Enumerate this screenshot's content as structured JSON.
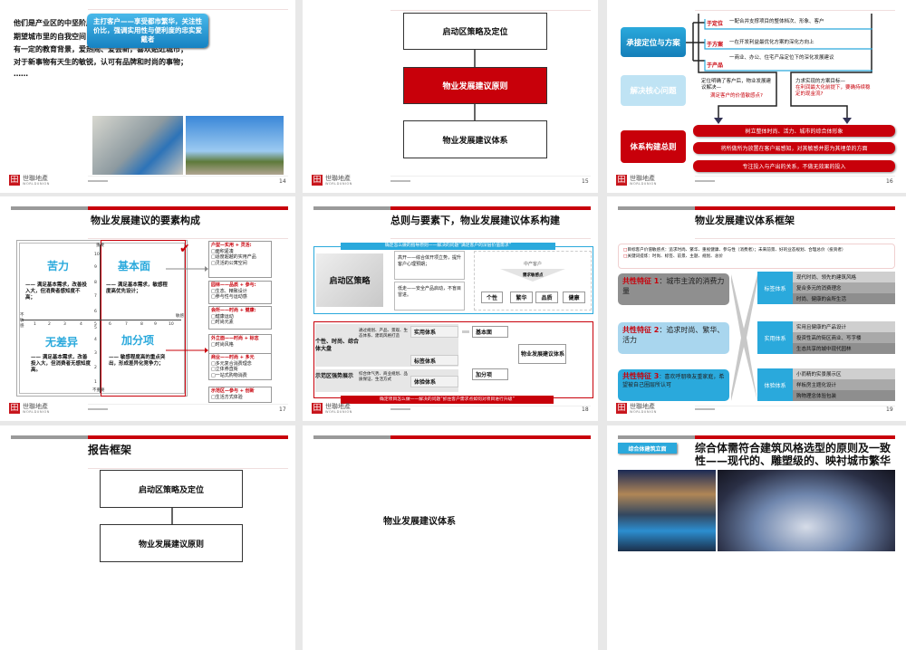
{
  "logo": {
    "cn": "世聯地產",
    "en": "WORLDUNION",
    "mark": "田"
  },
  "s14": {
    "page": "14",
    "lines": [
      "他们是产业区的中坚阶层，事业发展蒸蒸日上；",
      "期望城市里的自我空间，讲究生活便利和环境的舒适；",
      "有一定的教育背景，爱热闹、爱尝新，喜欢贴近城市；",
      "对于新事物有天生的敏锐，认可有品牌和时尚的事物；",
      "……"
    ],
    "callout": "主打客户——享受都市繁华，关注性价比，强调实用性与便利度的忠实爱戴者"
  },
  "s15": {
    "page": "15",
    "boxes": [
      "启动区策略及定位",
      "物业发展建议原则",
      "物业发展建议体系"
    ]
  },
  "s16": {
    "page": "16",
    "left": [
      "承接定位与方案",
      "解决核心问题",
      "体系构建总则"
    ],
    "branches": [
      {
        "k": "于定位",
        "v": "一配合并支撑项目的整体档次、形象、客户"
      },
      {
        "k": "于方案",
        "v": "一在开发利益最优化方案的深化方向上"
      },
      {
        "k": "于产品",
        "v": "一商业、办公、住宅产品定位下的深化发展建议"
      }
    ],
    "q_left": "定位明确了客户后，物业发展建议解决—",
    "q_left_red": "满足客户的价值敏感点?",
    "q_right": "力求实现的方案目标—",
    "q_right_red": "在利润最大化前提下，要确持续稳定的现金流?",
    "pills": [
      "树立整体时尚、活力、城市的综合体形象",
      "将所做所为放置在客户易感知，对其敏感并愿为其埋单的方面",
      "专注投入与产出的关系，不做无效果的投入"
    ]
  },
  "s17": {
    "page": "17",
    "title": "物业发展建议的要素构成",
    "quads": [
      {
        "t": "苦力",
        "d": "—— 满足基本需求，改善投入大，但消费者感知度不高；"
      },
      {
        "t": "基本面",
        "d": "—— 满足基本需求，敏感程度高优先设计；"
      },
      {
        "t": "无差异",
        "d": "—— 满足基本需求，改善投入大，但消费者无感知度高。"
      },
      {
        "t": "加分项",
        "d": "—— 敏感程度高的重点突出，形成差异化竞争力；"
      }
    ],
    "axis": {
      "top": "重要",
      "bottom": "不重要",
      "left": "不敏感",
      "right": "敏感",
      "x": [
        "1",
        "2",
        "3",
        "4",
        "5",
        "6",
        "7",
        "8",
        "9",
        "10"
      ],
      "y_up": [
        "10",
        "9",
        "8",
        "7",
        "6"
      ],
      "y_down": [
        "5",
        "4",
        "3",
        "2",
        "1"
      ]
    },
    "panels": [
      {
        "h": "户型—实用 + 灵活:",
        "items": [
          "面积紧凑",
          "适度超越的实用产品",
          "灵活的公寓空间"
        ]
      },
      {
        "h": "园林——品质 + 参与:",
        "items": [
          "生态、精致设计",
          "参与性与运动感"
        ]
      },
      {
        "h": "会所——时尚 + 健康:",
        "items": [
          "健康运动",
          "时尚元素"
        ]
      },
      {
        "h": "外立面——时尚 + 标志",
        "items": [
          "时尚风格"
        ]
      },
      {
        "h": "商业——时尚 + 多元",
        "items": [
          "多元复合消费理念",
          "立体券直街",
          "一站式购物消费"
        ]
      },
      {
        "h": "示范区—参与 + 创新",
        "items": [
          "生活方式体验"
        ]
      }
    ]
  },
  "s18": {
    "page": "18",
    "title": "总则与要素下，物业发展建议体系构建",
    "top_banner": "确定怎么做的指导原则——解决的问题“满足客户的深层价值需求”",
    "strategy": "启动区策略",
    "t1": "高开——综合体开项立势，提升客户心理预期；",
    "t2": "低走——安全产品启动，不盲目冒进。",
    "customer": "中产客户",
    "needs": "需求敏感点",
    "tags": [
      "个性",
      "繁华",
      "品质",
      "健康"
    ],
    "g1": "个性、时尚、综合体大盘",
    "g1d": "通过规划、产品、景观、生态体系、建筑风格打造",
    "g2": "示范区强势展示",
    "g2d": "综合体气势、商业规划、品质保证、生活方式",
    "sys": [
      "实用体系",
      "标签体系",
      "体验体系"
    ],
    "base": "基本面",
    "bonus": "加分项",
    "result": "物业发展建议体系",
    "bottom_banner": "确定项目怎么做——解决的问题“抓住客户需求点如何对项目进行升级”"
  },
  "s19": {
    "page": "19",
    "title": "物业发展建议体系框架",
    "notes": [
      "目标客户价值敏感点：追求时尚、繁华、重视健康、参与性（消费者）；未来前景、好的业态规划、合理总价（投资者）",
      "关键词提炼：时尚、标签、前景、主题、规划、总价"
    ],
    "features": [
      {
        "k": "共性特征 1",
        "v": "：城市主流的消费力量"
      },
      {
        "k": "共性特征 2",
        "v": "：追求时尚、繁华、活力"
      },
      {
        "k": "共性特征 3",
        "v": "：喜欢呼朋唤友重家庭，希望被自己圈层所认可"
      }
    ],
    "systems": [
      {
        "name": "标签体系",
        "rows": [
          "现代时尚、领先的建筑风格",
          "复合多元的消费理念",
          "时尚、健康的会所生活"
        ]
      },
      {
        "name": "实用体系",
        "rows": [
          "实用且健康的产品设计",
          "投资性高的街区商业、写字楼",
          "生态共享的城中现代园林"
        ]
      },
      {
        "name": "体验体系",
        "rows": [
          "小而精的实景展示区",
          "样板房主题化设计",
          "购物理念体验包装"
        ]
      }
    ]
  },
  "s20": {
    "title": "报告框架",
    "boxes": [
      "启动区策略及定位",
      "物业发展建议原则"
    ]
  },
  "s21": {
    "text": "物业发展建议体系"
  },
  "s22": {
    "tag": "综合体建筑立面",
    "title": "综合体需符合建筑风格选型的原则及一致性——现代的、雕塑级的、映衬城市繁华"
  },
  "colors": {
    "red": "#c8000a",
    "blue": "#2aa9dc",
    "gray": "#9a9a9a"
  }
}
